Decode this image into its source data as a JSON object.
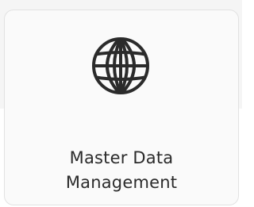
{
  "tile": {
    "icon": "globe-icon",
    "label_line1": "Master Data",
    "label_line2": "Management"
  },
  "colors": {
    "icon_stroke": "#2b2b2b",
    "label_text": "#2b2b2b",
    "tile_background": "#fafafa",
    "tile_border": "#e2e2e2",
    "page_background_top": "#f5f5f5",
    "page_background_bottom": "#ffffff"
  }
}
